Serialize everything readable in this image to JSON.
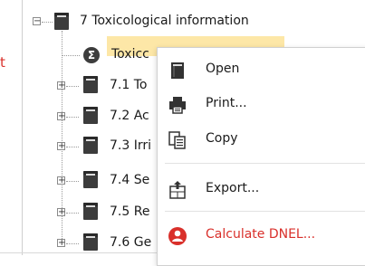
{
  "left_fragment": "t",
  "tree": {
    "section_title": "7 Toxicological information",
    "selected_item": "Toxicc",
    "items": [
      {
        "label": "7.1 To"
      },
      {
        "label": "7.2 Ac"
      },
      {
        "label": "7.3 Irri"
      },
      {
        "label": "7.4 Se"
      },
      {
        "label": "7.5 Re"
      },
      {
        "label": "7.6 Ge"
      }
    ]
  },
  "context_menu": {
    "items": [
      {
        "label": "Open",
        "icon": "book-icon"
      },
      {
        "label": "Print...",
        "icon": "printer-icon"
      },
      {
        "label": "Copy",
        "icon": "copy-icon"
      },
      {
        "label": "Export...",
        "icon": "export-icon"
      },
      {
        "label": "Calculate DNEL...",
        "icon": "person-icon",
        "color": "#d9302b"
      }
    ]
  },
  "colors": {
    "selection": "#fde7a7",
    "accent_red": "#d9302b"
  }
}
